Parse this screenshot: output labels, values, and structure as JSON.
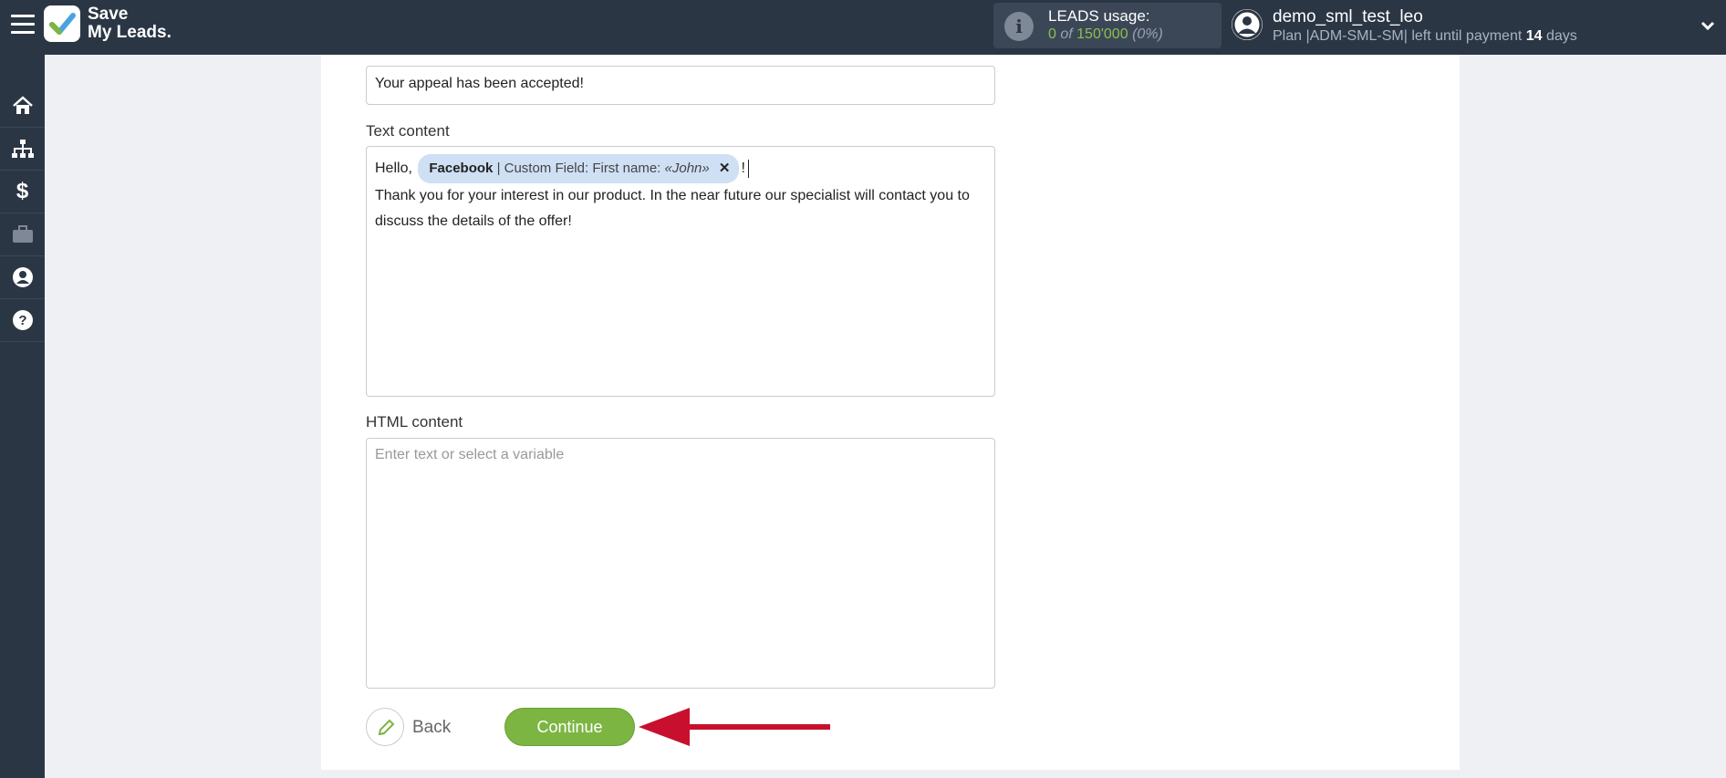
{
  "app": {
    "logo_line1": "Save",
    "logo_line2": "My Leads."
  },
  "header": {
    "leads_usage_title": "LEADS usage:",
    "leads_used": "0",
    "leads_of": "of",
    "leads_total": "150'000",
    "leads_percent": "(0%)",
    "user_name": "demo_sml_test_leo",
    "plan_prefix": "Plan |ADM-SML-SM| left until payment",
    "plan_days": "14",
    "plan_days_suffix": "days"
  },
  "sidebar": {
    "items": [
      {
        "icon": "home-icon"
      },
      {
        "icon": "sitemap-icon"
      },
      {
        "icon": "dollar-icon"
      },
      {
        "icon": "briefcase-icon"
      },
      {
        "icon": "user-circle-icon"
      },
      {
        "icon": "help-icon"
      }
    ]
  },
  "form": {
    "subject_value": "Your appeal has been accepted!",
    "text_label": "Text content",
    "text_greeting": "Hello,",
    "chip_source": "Facebook",
    "chip_field": "| Custom Field: First name:",
    "chip_value": "«John»",
    "chip_remove": "✕",
    "text_after_chip": "!",
    "text_body_line1": "Thank you for your interest in our product. In the near future our specialist will contact you to",
    "text_body_line2": "discuss the details of the offer!",
    "html_label": "HTML content",
    "html_placeholder": "Enter text or select a variable"
  },
  "actions": {
    "back_label": "Back",
    "continue_label": "Continue"
  },
  "colors": {
    "topbar": "#2b3645",
    "accent_green": "#7cb542",
    "arrow_red": "#c8102e"
  }
}
